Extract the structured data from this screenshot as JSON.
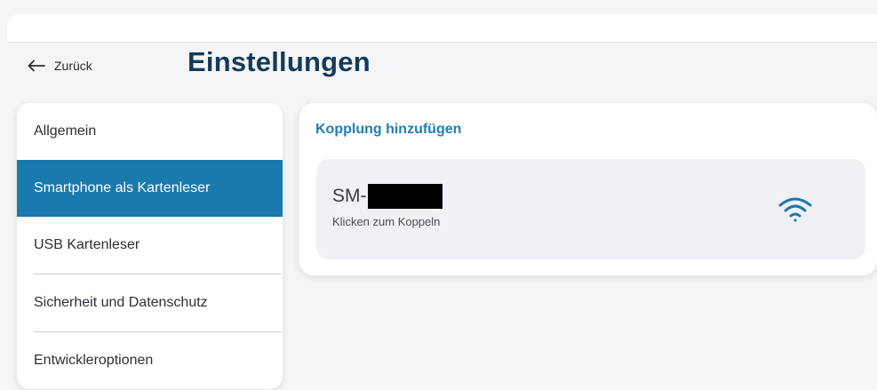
{
  "header": {
    "back_label": "Zurück",
    "title": "Einstellungen"
  },
  "sidebar": {
    "items": [
      {
        "label": "Allgemein",
        "active": false
      },
      {
        "label": "Smartphone als Kartenleser",
        "active": true
      },
      {
        "label": "USB Kartenleser",
        "active": false
      },
      {
        "label": "Sicherheit und Datenschutz",
        "active": false
      },
      {
        "label": "Entwickleroptionen",
        "active": false
      }
    ]
  },
  "main": {
    "section_title": "Kopplung hinzufügen",
    "device": {
      "name": "SM-",
      "hint": "Klicken zum Koppeln",
      "icon": "wifi-icon"
    }
  },
  "colors": {
    "accent": "#1a79ad",
    "title": "#143a56",
    "section": "#1d7fb6"
  }
}
